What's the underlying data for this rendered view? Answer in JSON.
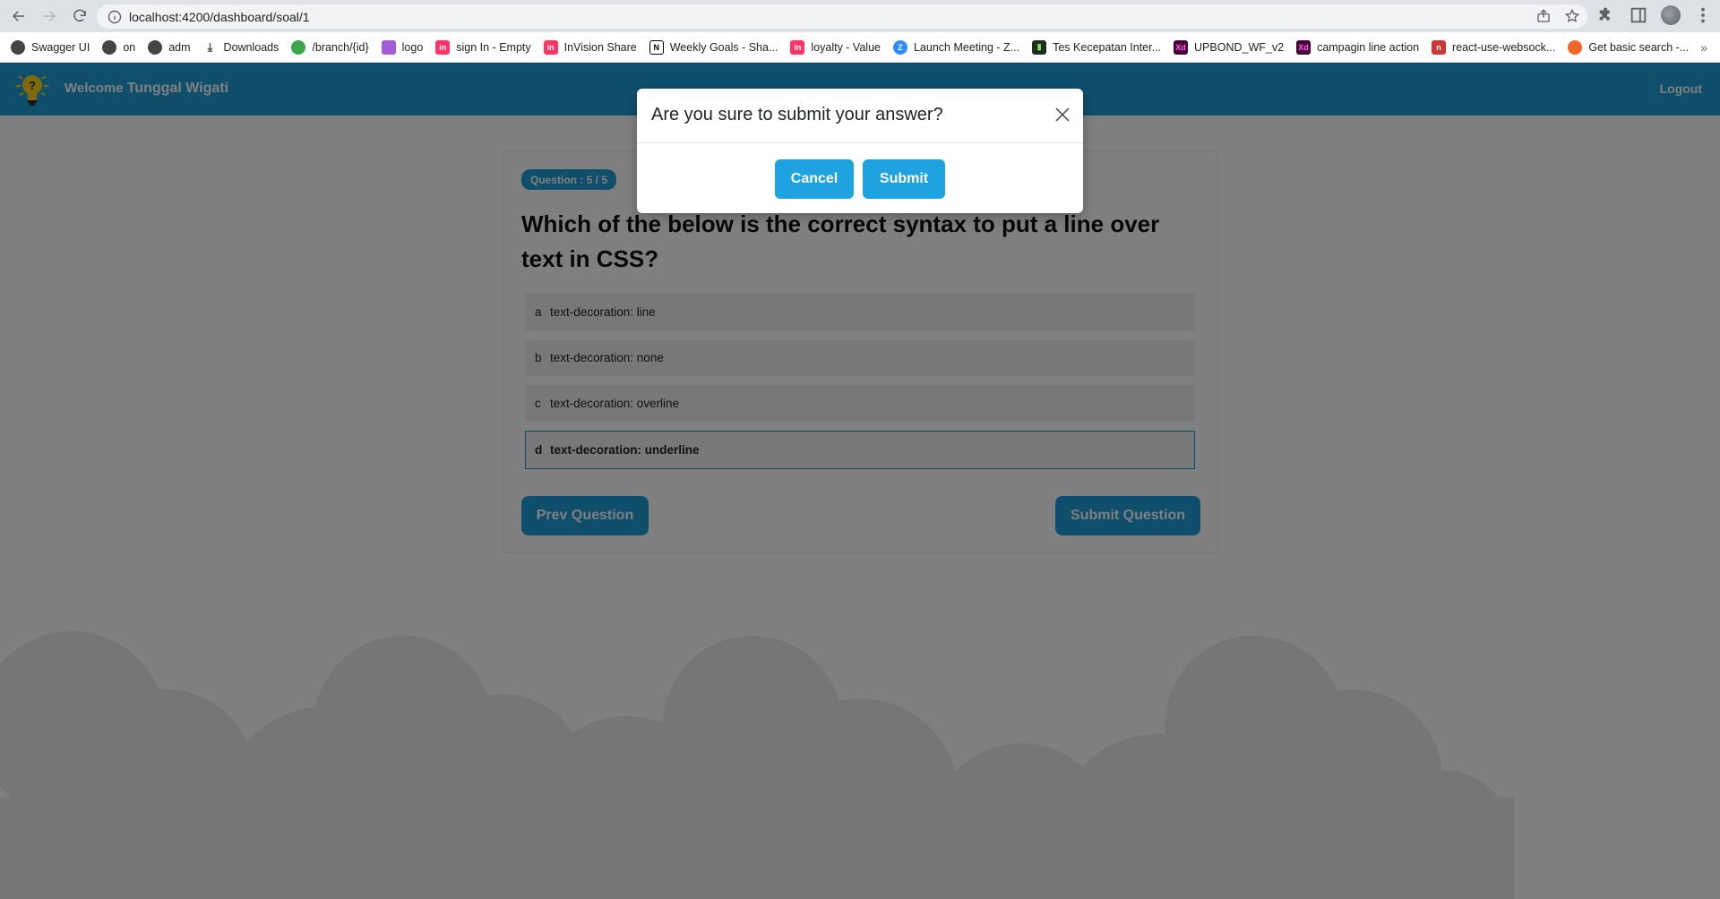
{
  "browser": {
    "url": "localhost:4200/dashboard/soal/1",
    "bookmarks": [
      {
        "label": "Swagger UI",
        "icon": "globe-icon"
      },
      {
        "label": "on",
        "icon": "globe-icon"
      },
      {
        "label": "adm",
        "icon": "globe-icon"
      },
      {
        "label": "Downloads",
        "icon": "download-icon"
      },
      {
        "label": "/branch/{id}",
        "icon": "green-circle-icon"
      },
      {
        "label": "logo",
        "icon": "purple-bug-icon"
      },
      {
        "label": "sign In - Empty",
        "icon": "invision-icon"
      },
      {
        "label": "InVision Share",
        "icon": "invision-icon"
      },
      {
        "label": "Weekly Goals - Sha...",
        "icon": "notion-icon"
      },
      {
        "label": "loyalty - Value",
        "icon": "invision-icon"
      },
      {
        "label": "Launch Meeting - Z...",
        "icon": "zoom-icon"
      },
      {
        "label": "Tes Kecepatan Inter...",
        "icon": "speedtest-icon"
      },
      {
        "label": "UPBOND_WF_v2",
        "icon": "xd-icon"
      },
      {
        "label": "campagin line action",
        "icon": "xd-icon"
      },
      {
        "label": "react-use-websock...",
        "icon": "npm-icon"
      },
      {
        "label": "Get basic search -...",
        "icon": "orange-icon"
      }
    ]
  },
  "header": {
    "welcome_prefix": "Welcome",
    "user_name": "Tunggal Wigati",
    "logout_label": "Logout"
  },
  "quiz": {
    "badge": "Question : 5 / 5",
    "question": "Which of the below is the correct syntax to put a line over text in CSS?",
    "options": [
      {
        "letter": "a",
        "text": "text-decoration: line"
      },
      {
        "letter": "b",
        "text": "text-decoration: none"
      },
      {
        "letter": "c",
        "text": "text-decoration: overline"
      },
      {
        "letter": "d",
        "text": "text-decoration: underline"
      }
    ],
    "selected": "d",
    "prev_label": "Prev Question",
    "submit_label": "Submit Question"
  },
  "modal": {
    "title": "Are you sure to submit your answer?",
    "cancel_label": "Cancel",
    "submit_label": "Submit"
  },
  "colors": {
    "brand": "#1f9fd9",
    "modal_button": "#1fa3e0"
  }
}
